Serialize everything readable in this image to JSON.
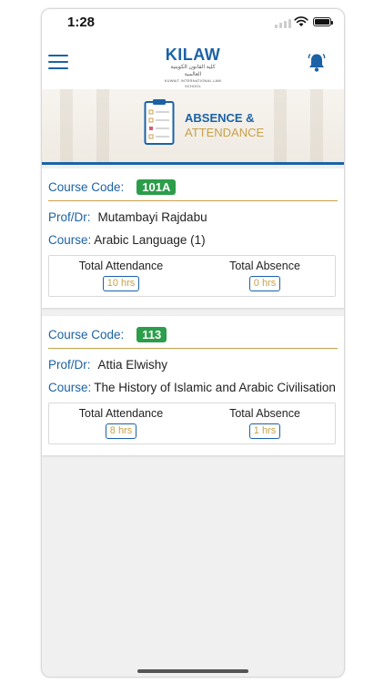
{
  "status_bar": {
    "time": "1:28"
  },
  "header": {
    "logo": {
      "name": "KILAW",
      "arabic": "كلية القانون الكويتية العالمية",
      "english": "KUWAIT INTERNATIONAL LAW SCHOOL"
    }
  },
  "banner": {
    "title_line1": "ABSENCE &",
    "title_line2": "ATTENDANCE"
  },
  "labels": {
    "course_code": "Course Code:",
    "prof": "Prof/Dr:",
    "course": "Course:",
    "total_attendance": "Total Attendance",
    "total_absence": "Total Absence"
  },
  "courses": [
    {
      "code": "101A",
      "prof": "Mutambayi Rajdabu",
      "course": "Arabic Language (1)",
      "attendance": "10 hrs",
      "absence": "0 hrs"
    },
    {
      "code": "113",
      "prof": "Attia Elwishy",
      "course": "The History of Islamic and Arabic Civilisation",
      "attendance": "8 hrs",
      "absence": "1 hrs"
    }
  ],
  "colors": {
    "brand_blue": "#1b62a6",
    "gold": "#c8a149",
    "badge_green": "#2c9d4a"
  },
  "icons": [
    "menu-icon",
    "bell-icon",
    "clipboard-icon",
    "wifi-icon",
    "battery-icon",
    "signal-icon"
  ]
}
